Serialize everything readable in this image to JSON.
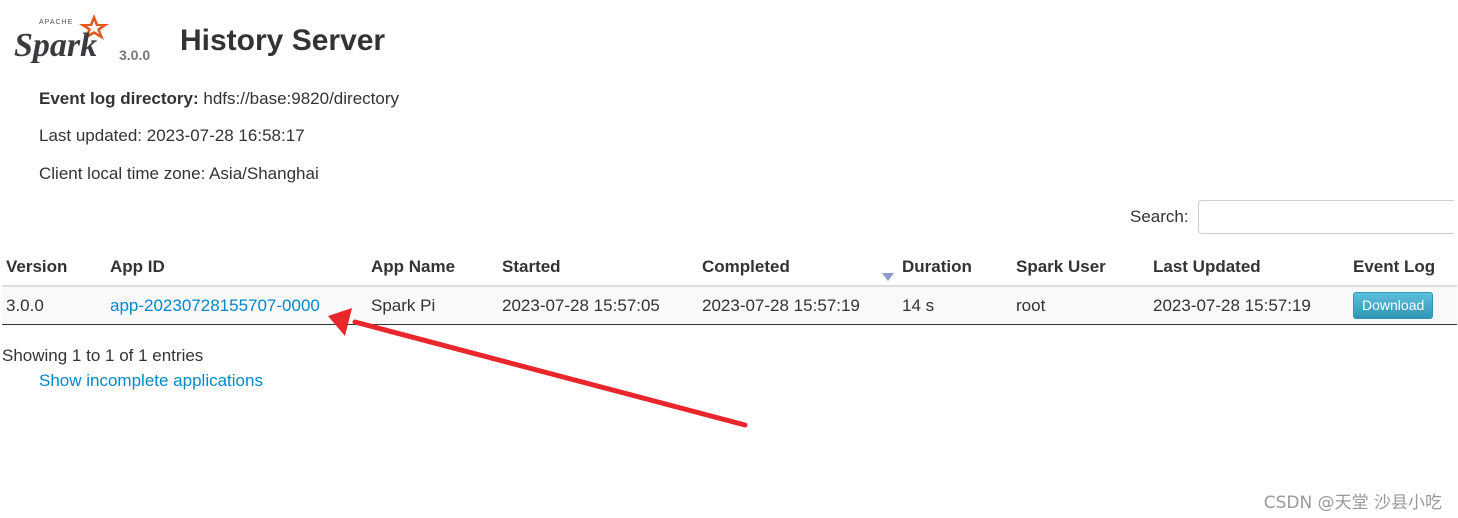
{
  "header": {
    "logo_alt": "Spark",
    "version": "3.0.0",
    "title": "History Server"
  },
  "info": {
    "event_log_label": "Event log directory:",
    "event_log_value": "hdfs://base:9820/directory",
    "last_updated": "Last updated: 2023-07-28 16:58:17",
    "timezone": "Client local time zone: Asia/Shanghai"
  },
  "search": {
    "label": "Search:",
    "value": "",
    "placeholder": ""
  },
  "table": {
    "columns": [
      "Version",
      "App ID",
      "App Name",
      "Started",
      "Completed",
      "Duration",
      "Spark User",
      "Last Updated",
      "Event Log"
    ],
    "sorted_column": "Completed",
    "rows": [
      {
        "version": "3.0.0",
        "app_id": "app-20230728155707-0000",
        "app_name": "Spark Pi",
        "started": "2023-07-28 15:57:05",
        "completed": "2023-07-28 15:57:19",
        "duration": "14 s",
        "spark_user": "root",
        "last_updated": "2023-07-28 15:57:19",
        "event_log": "Download"
      }
    ]
  },
  "footer": {
    "entries": "Showing 1 to 1 of 1 entries",
    "show_incomplete": "Show incomplete applications"
  },
  "annotation": {
    "arrow_color": "#e8262b"
  },
  "watermark": "CSDN @天堂 沙县小吃",
  "colors": {
    "link": "#0088cc",
    "download_button": "#49afcd",
    "text": "#333333"
  }
}
